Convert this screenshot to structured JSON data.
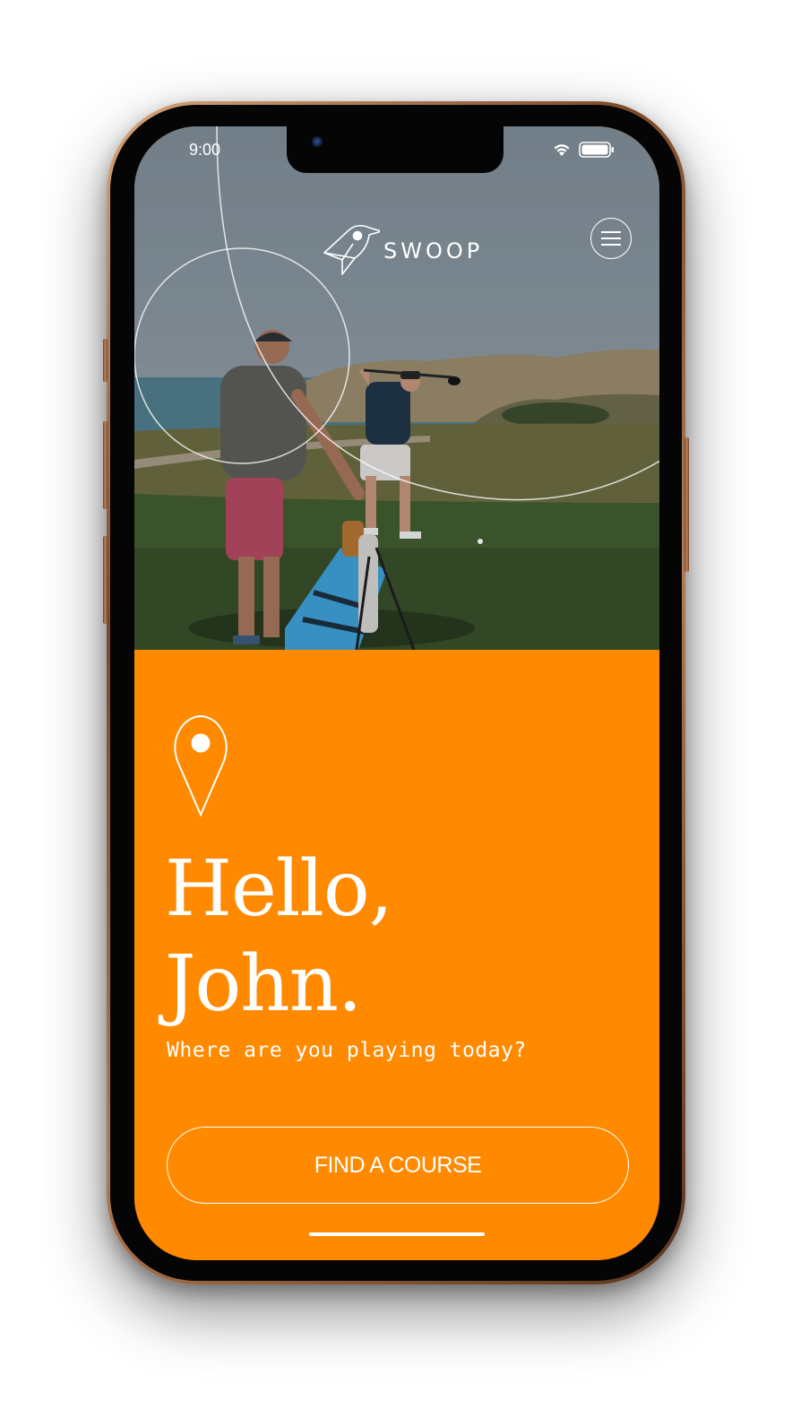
{
  "status_bar": {
    "time": "9:00",
    "wifi_icon": "wifi-icon",
    "battery_icon": "battery-icon"
  },
  "header": {
    "logo_icon": "swoop-bird-icon",
    "logo_text": "SWOOP",
    "menu_icon": "hamburger-menu-icon"
  },
  "hero": {
    "image": "golfers-on-course-photo"
  },
  "main": {
    "location_icon": "map-pin-icon",
    "greeting_line1": "Hello,",
    "greeting_line2": "John.",
    "subtitle": "Where are you playing today?",
    "cta_label": "FIND A COURSE"
  },
  "colors": {
    "accent": "#FF8A00",
    "text_on_accent": "#FFFFFF"
  }
}
